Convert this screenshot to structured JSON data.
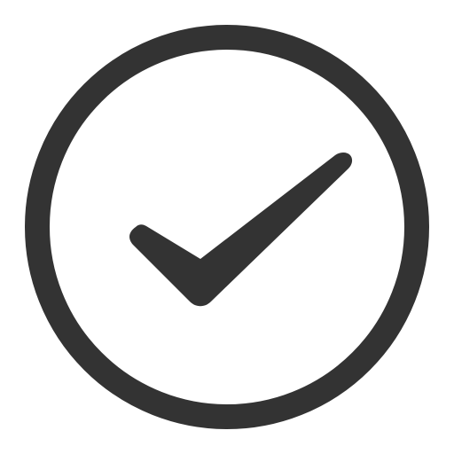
{
  "icon": {
    "name": "check-circle-icon",
    "color": "#333333",
    "background": "#ffffff"
  }
}
